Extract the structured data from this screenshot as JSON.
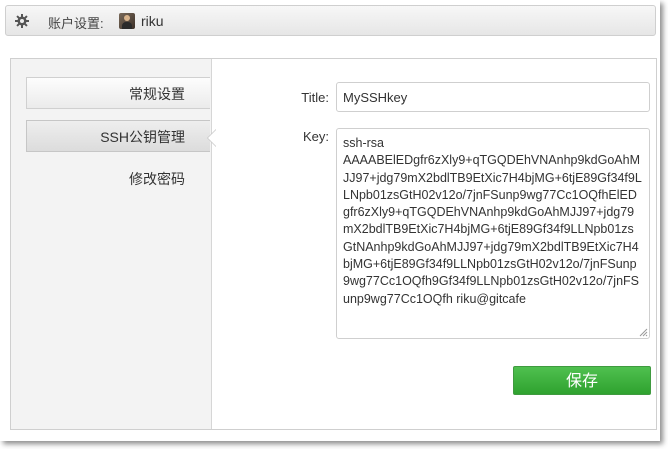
{
  "header": {
    "icon": "gear-icon",
    "title": "账户设置:",
    "username": "riku"
  },
  "sidebar": {
    "items": [
      {
        "label": "常规设置",
        "state": "normal"
      },
      {
        "label": "SSH公钥管理",
        "state": "active"
      },
      {
        "label": "修改密码",
        "state": "plain"
      }
    ]
  },
  "form": {
    "title_label": "Title:",
    "title_value": "MySSHkey",
    "key_label": "Key:",
    "key_value": "ssh-rsa\nAAAABElEDgfr6zXly9+qTGQDEhVNAnhp9kdGoAhMJJ97+jdg79mX2bdlTB9EtXic7H4bjMG+6tjE89Gf34f9LLNpb01zsGtH02v12o/7jnFSunp9wg77Cc1OQfhElEDgfr6zXly9+qTGQDEhVNAnhp9kdGoAhMJJ97+jdg79mX2bdlTB9EtXic7H4bjMG+6tjE89Gf34f9LLNpb01zsGtNAnhp9kdGoAhMJJ97+jdg79mX2bdlTB9EtXic7H4bjMG+6tjE89Gf34f9LLNpb01zsGtH02v12o/7jnFSunp9wg77Cc1OQfh9Gf34f9LLNpb01zsGtH02v12o/7jnFSunp9wg77Cc1OQfh riku@gitcafe",
    "save_label": "保存"
  },
  "colors": {
    "save_button": "#3aad3a",
    "sidebar_bg": "#f3f3f3"
  }
}
